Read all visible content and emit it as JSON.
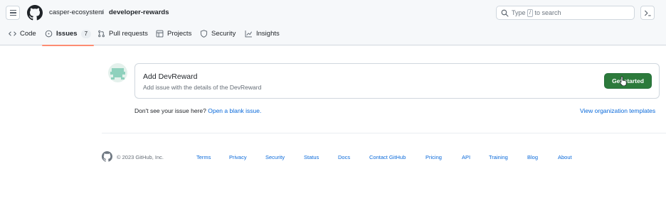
{
  "header": {
    "owner": "casper-ecosystem",
    "separator": "/",
    "repo": "developer-rewards",
    "search": {
      "prefix": "Type",
      "key": "/",
      "suffix": "to search"
    }
  },
  "tabs": [
    {
      "label": "Code",
      "icon": "code-icon"
    },
    {
      "label": "Issues",
      "icon": "issue-opened-icon",
      "count": "7",
      "active": true
    },
    {
      "label": "Pull requests",
      "icon": "pull-request-icon"
    },
    {
      "label": "Projects",
      "icon": "table-icon"
    },
    {
      "label": "Security",
      "icon": "shield-icon"
    },
    {
      "label": "Insights",
      "icon": "graph-icon"
    }
  ],
  "template": {
    "title": "Add DevReward",
    "description": "Add issue with the details of the DevReward",
    "button": "Get started"
  },
  "blank_issue": {
    "prompt": "Don't see your issue here?",
    "link": "Open a blank issue."
  },
  "org_templates_link": "View organization templates",
  "footer": {
    "copyright": "© 2023 GitHub, Inc.",
    "links": [
      "Terms",
      "Privacy",
      "Security",
      "Status",
      "Docs",
      "Contact GitHub",
      "Pricing",
      "API",
      "Training",
      "Blog",
      "About"
    ]
  },
  "colors": {
    "accent_green": "#2c7a3b",
    "link_blue": "#0969da",
    "active_tab_underline": "#fd8c73"
  }
}
